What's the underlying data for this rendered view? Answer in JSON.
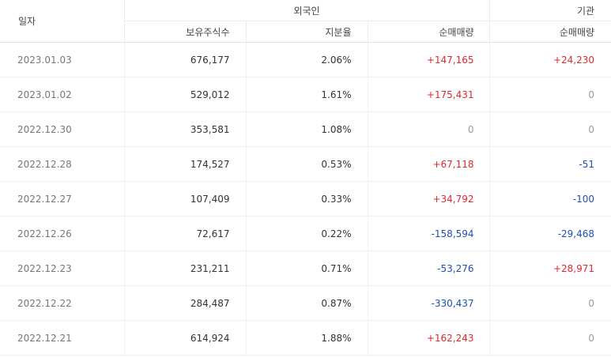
{
  "header": {
    "date": "일자",
    "foreign_group": "외국인",
    "institution_group": "기관",
    "holdings": "보유주식수",
    "ratio": "지분율",
    "foreign_net": "순매매량",
    "institution_net": "순매매량"
  },
  "rows": [
    {
      "date": "2023.01.03",
      "holdings": "676,177",
      "ratio": "2.06%",
      "foreign_net": "+147,165",
      "institution_net": "+24,230"
    },
    {
      "date": "2023.01.02",
      "holdings": "529,012",
      "ratio": "1.61%",
      "foreign_net": "+175,431",
      "institution_net": "0"
    },
    {
      "date": "2022.12.30",
      "holdings": "353,581",
      "ratio": "1.08%",
      "foreign_net": "0",
      "institution_net": "0"
    },
    {
      "date": "2022.12.28",
      "holdings": "174,527",
      "ratio": "0.53%",
      "foreign_net": "+67,118",
      "institution_net": "-51"
    },
    {
      "date": "2022.12.27",
      "holdings": "107,409",
      "ratio": "0.33%",
      "foreign_net": "+34,792",
      "institution_net": "-100"
    },
    {
      "date": "2022.12.26",
      "holdings": "72,617",
      "ratio": "0.22%",
      "foreign_net": "-158,594",
      "institution_net": "-29,468"
    },
    {
      "date": "2022.12.23",
      "holdings": "231,211",
      "ratio": "0.71%",
      "foreign_net": "-53,276",
      "institution_net": "+28,971"
    },
    {
      "date": "2022.12.22",
      "holdings": "284,487",
      "ratio": "0.87%",
      "foreign_net": "-330,437",
      "institution_net": "0"
    },
    {
      "date": "2022.12.21",
      "holdings": "614,924",
      "ratio": "1.88%",
      "foreign_net": "+162,243",
      "institution_net": "0"
    }
  ],
  "colors": {
    "positive": "#e0292d",
    "negative": "#1d4fb8",
    "zero": "#999999"
  }
}
